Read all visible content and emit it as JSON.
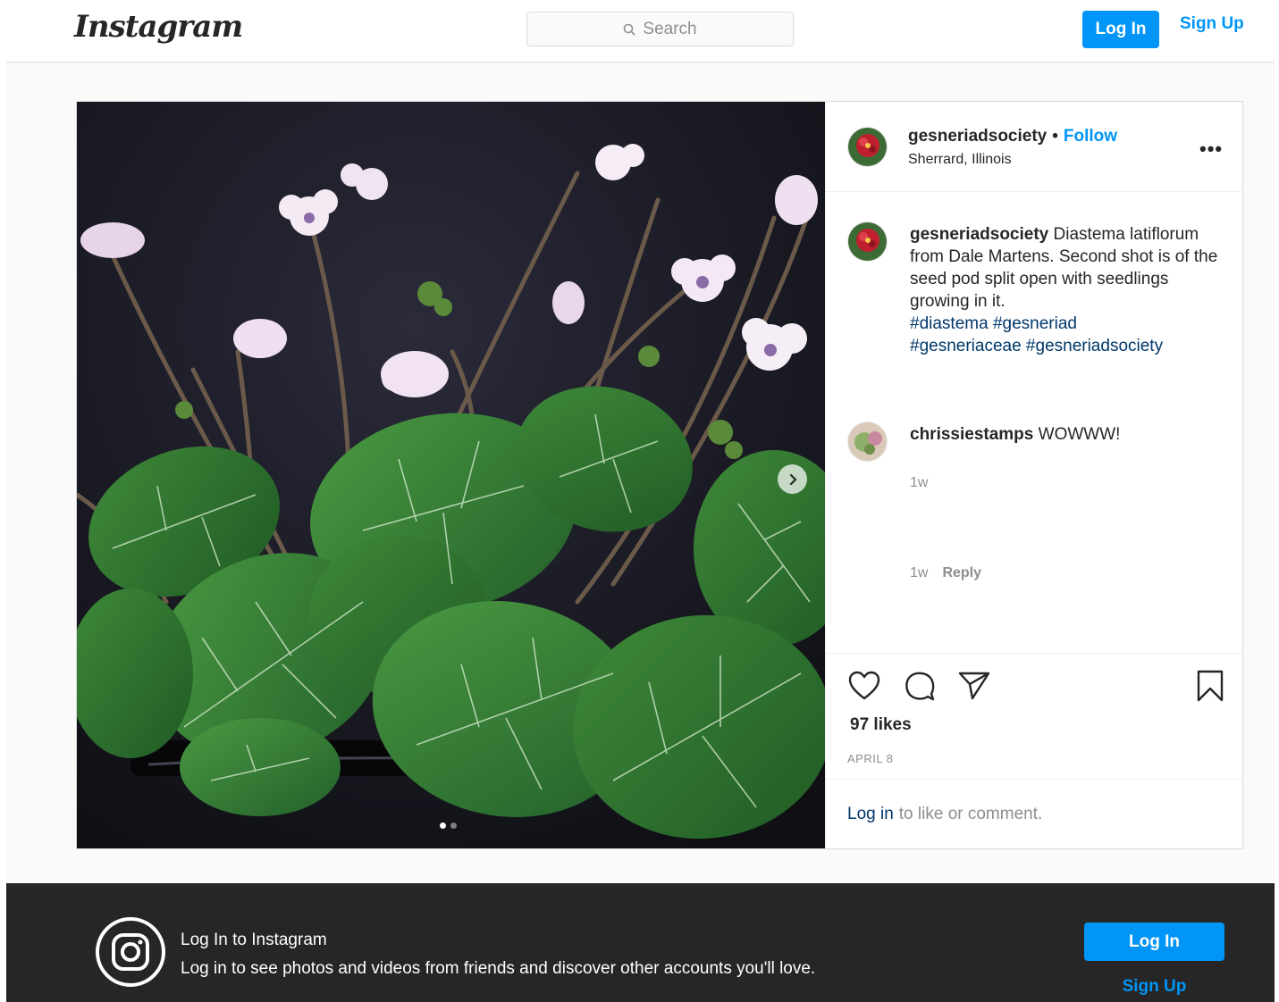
{
  "header": {
    "logo": "Instagram",
    "search_placeholder": "Search",
    "login_label": "Log In",
    "signup_label": "Sign Up"
  },
  "post": {
    "username": "gesneriadsociety",
    "separator": "•",
    "follow_label": "Follow",
    "location": "Sherrard, Illinois",
    "more_label": "•••",
    "caption": {
      "username": "gesneriadsociety",
      "text": " Diastema latiflorum from Dale Martens. Second shot is of the seed pod split open with seedlings growing in it.",
      "hashtags_line1": "#diastema #gesneriad",
      "hashtags_line2": "#gesneriaceae #gesneriadsociety",
      "time": "1w"
    },
    "comments": [
      {
        "username": "chrissiestamps",
        "text": " WOWWW!",
        "time": "1w",
        "reply_label": "Reply"
      }
    ],
    "likes": "97 likes",
    "date": "APRIL 8",
    "login_link": "Log in",
    "login_suffix": "to like or comment.",
    "carousel": {
      "count": 2,
      "active": 1
    }
  },
  "icons": {
    "search": "search-icon",
    "like": "heart-icon",
    "comment": "comment-bubble-icon",
    "share": "paper-plane-icon",
    "save": "bookmark-icon",
    "next": "chevron-right-icon",
    "brand": "instagram-glyph-icon"
  },
  "banner": {
    "title": "Log In to Instagram",
    "subtitle": "Log in to see photos and videos from friends and discover other accounts you'll love.",
    "login_label": "Log In",
    "signup_label": "Sign Up"
  },
  "colors": {
    "accent": "#0095f6",
    "link_dark": "#00376b",
    "banner_bg": "#262626"
  }
}
